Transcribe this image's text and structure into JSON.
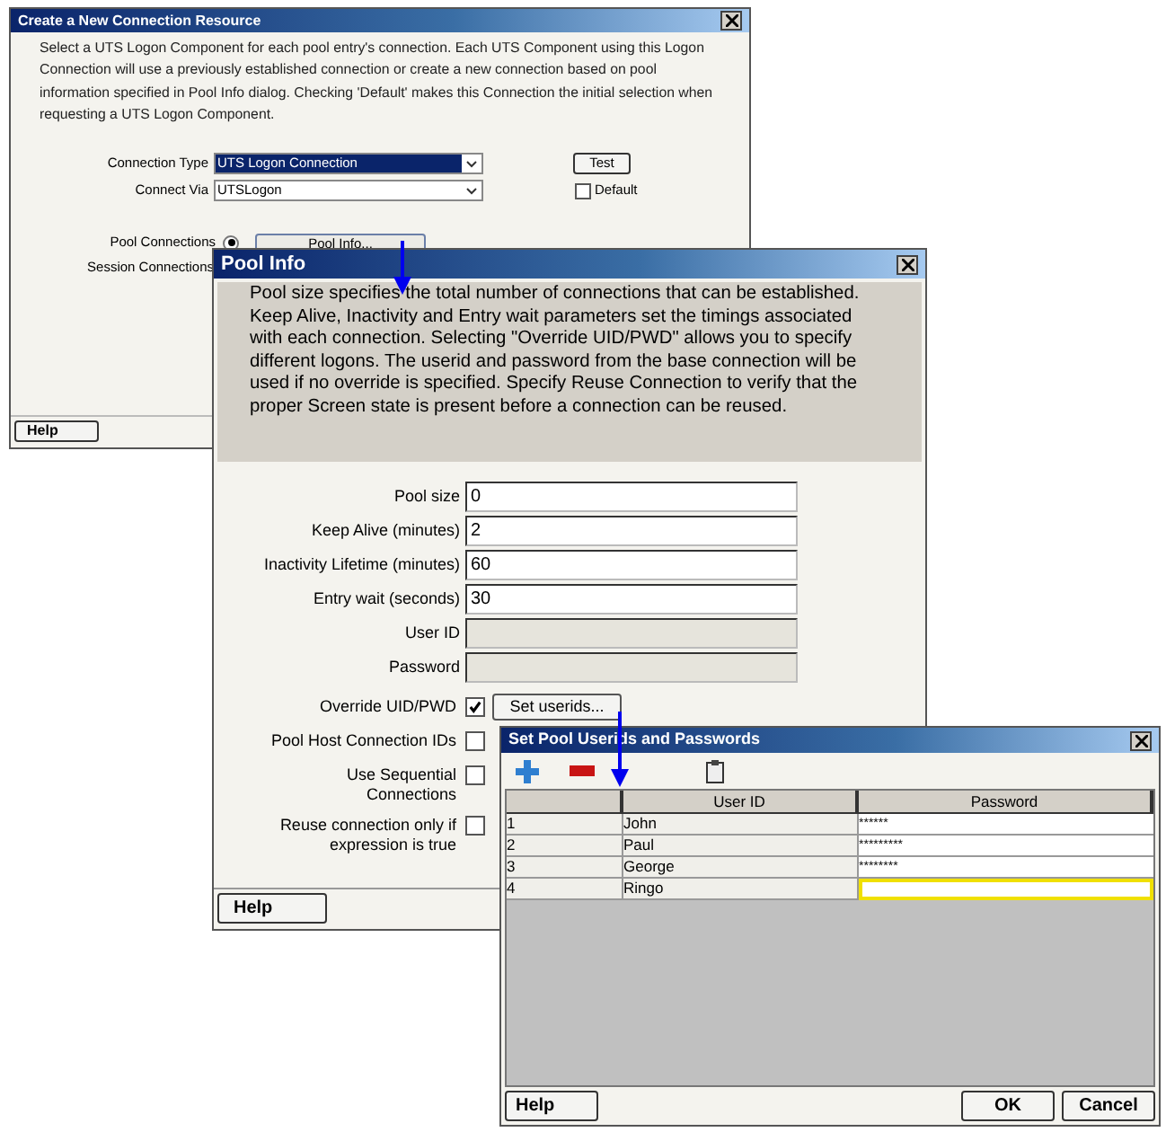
{
  "connection_window": {
    "title": "Create a New Connection Resource",
    "description": "Select a UTS Logon Component for each pool entry's connection. Each UTS Component using this Logon Connection will use a previously established connection or create a new connection based on pool information specified in Pool Info dialog. Checking 'Default' makes this Connection the initial selection when requesting a UTS Logon Component.",
    "connection_type": {
      "label": "Connection Type",
      "value": "UTS Logon Connection",
      "selected": true
    },
    "connect_via": {
      "label": "Connect Via",
      "value": "UTSLogon",
      "selected": false
    },
    "test_button": "Test",
    "default_checkbox": {
      "label": "Default",
      "checked": false
    },
    "pool_connections": {
      "label": "Pool Connections",
      "selected": true,
      "button": "Pool Info..."
    },
    "session_connections": {
      "label": "Session Connections"
    },
    "help_button": "Help"
  },
  "pool_info_window": {
    "title": "Pool Info",
    "description": "Pool size specifies the total number of connections that can be established.  Keep Alive, Inactivity and Entry wait parameters set the timings associated with each connection.  Selecting \"Override UID/PWD\" allows you to specify different logons. The userid and password from the base connection will be used if no override is specified. Specify Reuse Connection to verify that the proper Screen state is present before a connection can be reused.",
    "fields": [
      {
        "label": "Pool size",
        "value": "0",
        "disabled": false
      },
      {
        "label": "Keep Alive (minutes)",
        "value": "2",
        "disabled": false
      },
      {
        "label": "Inactivity Lifetime (minutes)",
        "value": "60",
        "disabled": false
      },
      {
        "label": "Entry wait (seconds)",
        "value": "30",
        "disabled": false
      },
      {
        "label": "User ID",
        "disabled": true
      },
      {
        "label": "Password",
        "disabled": true
      }
    ],
    "checkboxes": [
      {
        "label": "Override UID/PWD",
        "checked": true,
        "button": "Set userids..."
      },
      {
        "label": "Pool Host Connection IDs",
        "checked": false
      },
      {
        "label": "Use Sequential Connections",
        "checked": false
      },
      {
        "label": "Reuse connection only if expression is true",
        "checked": false
      }
    ],
    "help_button": "Help"
  },
  "userids_window": {
    "title": "Set Pool Userids and Passwords",
    "table": {
      "columns": [
        "User ID",
        "Password"
      ],
      "rows": [
        {
          "index": "1",
          "user_id": "John",
          "password": "******",
          "selected": false
        },
        {
          "index": "2",
          "user_id": "Paul",
          "password": "*********",
          "selected": false
        },
        {
          "index": "3",
          "user_id": "George",
          "password": "********",
          "selected": false
        },
        {
          "index": "4",
          "user_id": "Ringo",
          "selected": true
        }
      ]
    },
    "buttons": [
      "Help",
      "OK",
      "Cancel"
    ]
  }
}
